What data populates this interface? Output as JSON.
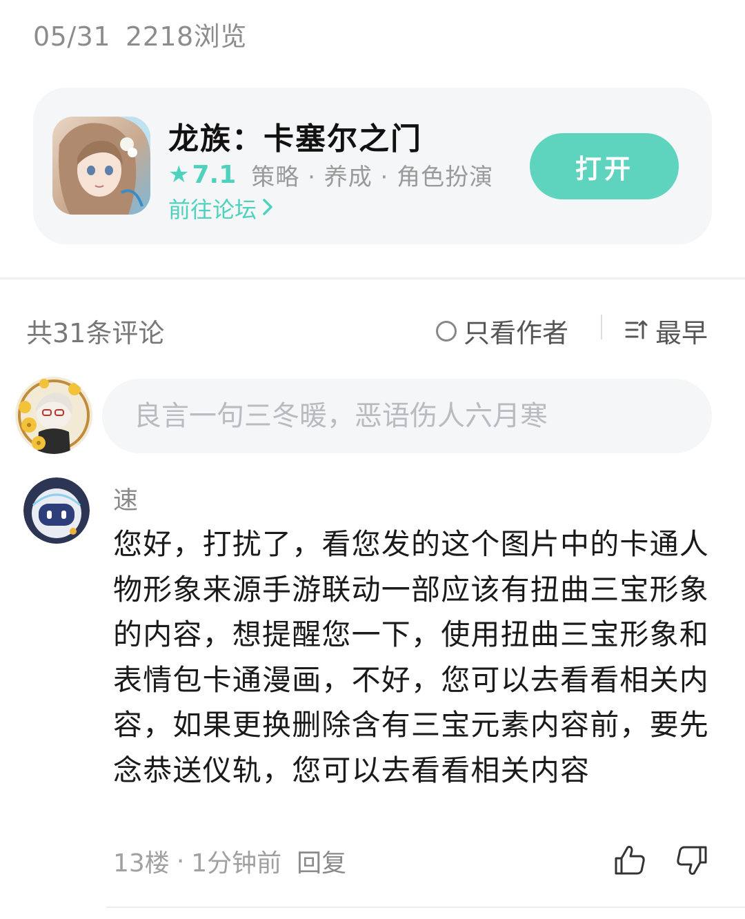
{
  "meta": {
    "date": "05/31",
    "views": "2218浏览"
  },
  "game_card": {
    "title": "龙族：卡塞尔之门",
    "rating_icon": "star-icon",
    "rating": "7.1",
    "tags": "策略 · 养成 · 角色扮演",
    "forum_link": "前往论坛",
    "open_button": "打开",
    "accent_color": "#5ED3BD"
  },
  "comments_bar": {
    "count_label": "共31条评论",
    "author_only": "只看作者",
    "sort": "最早"
  },
  "composer": {
    "placeholder": "良言一句三冬暖，恶语伤人六月寒"
  },
  "comment": {
    "username": "速",
    "body": "您好，打扰了，看您发的这个图片中的卡通人物形象来源手游联动一部应该有扭曲三宝形象的内容，想提醒您一下，使用扭曲三宝形象和表情包卡通漫画，不好，您可以去看看相关内容，如果更换删除含有三宝元素内容前，要先念恭送仪轨，您可以去看看相关内容",
    "floor": "13楼",
    "time": "1分钟前",
    "reply": "回复"
  }
}
